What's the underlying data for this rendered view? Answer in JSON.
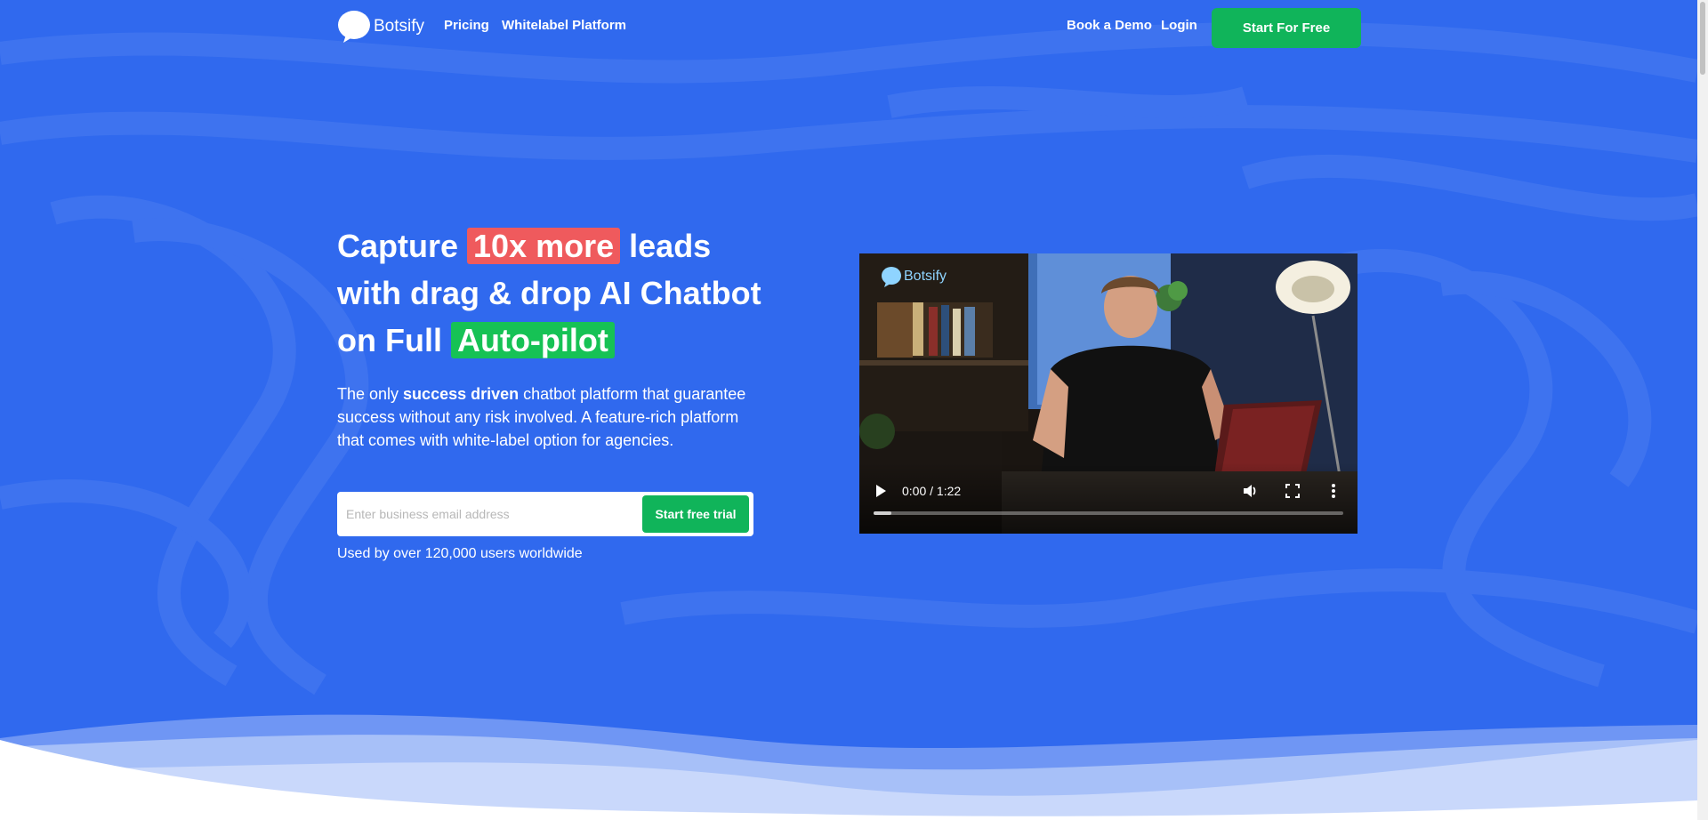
{
  "brand": {
    "name": "Botsify",
    "accent": "#3069ee",
    "green": "#10b45a",
    "red_highlight": "#ef5a5d",
    "green_highlight": "#16c255"
  },
  "nav": {
    "links": [
      "Pricing",
      "Whitelabel Platform"
    ],
    "book_demo": "Book a Demo",
    "login": "Login",
    "cta": "Start For Free"
  },
  "hero": {
    "headline": {
      "part1": "Capture ",
      "highlight1": "10x more",
      "part2": " leads",
      "line2": "with drag & drop AI Chatbot",
      "part3": "on Full ",
      "highlight2": "Auto-pilot"
    },
    "sub": {
      "pre": "The only ",
      "bold": "success driven",
      "post": " chatbot platform that guarantee success without any risk involved. A feature-rich platform that comes with white-label option for agencies."
    },
    "email_placeholder": "Enter business email address",
    "email_value": "",
    "trial_button": "Start free trial",
    "users_note": "Used by over 120,000 users worldwide"
  },
  "video": {
    "watermark": "Botsify",
    "time": "0:00 / 1:22",
    "progress": 0.0,
    "icons": [
      "play-icon",
      "volume-icon",
      "fullscreen-icon",
      "more-options-icon"
    ]
  }
}
